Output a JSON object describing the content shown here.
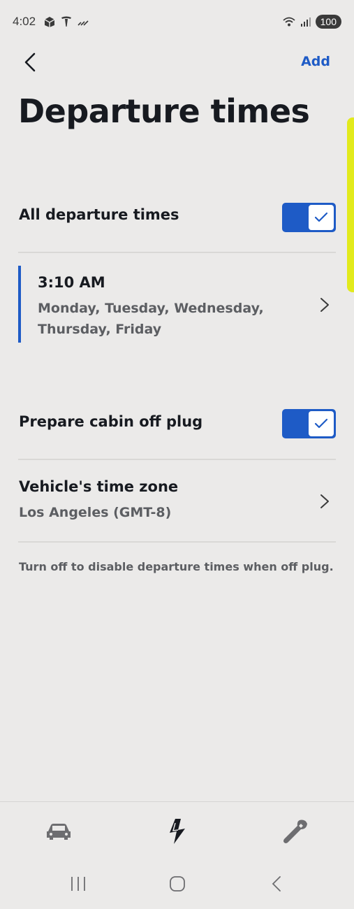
{
  "status_bar": {
    "time": "4:02",
    "battery": "100",
    "icons_left": [
      "gallery-icon",
      "tesla-logo-icon",
      "signal-slash-icon"
    ],
    "icons_right": [
      "wifi-icon",
      "cell-signal-icon"
    ]
  },
  "header": {
    "back_icon": "chevron-left-icon",
    "add_label": "Add",
    "title": "Departure times"
  },
  "all_departure": {
    "label": "All departure times",
    "enabled": true
  },
  "departures": [
    {
      "time": "3:10 AM",
      "days": "Monday, Tuesday, Wednesday, Thursday, Friday"
    }
  ],
  "prepare_cabin": {
    "label": "Prepare cabin off plug",
    "enabled": true
  },
  "timezone": {
    "title": "Vehicle's time zone",
    "value": "Los Angeles (GMT-8)"
  },
  "footnote": "Turn off to disable departure times when off plug.",
  "bottom_nav": [
    "car-icon",
    "charging-bolt-icon",
    "wrench-icon"
  ],
  "system_nav": [
    "recent-apps-icon",
    "home-icon",
    "back-icon"
  ],
  "colors": {
    "accent": "#1e5bc6",
    "background": "#ebeae9",
    "side_tab": "#e2ea1c"
  }
}
